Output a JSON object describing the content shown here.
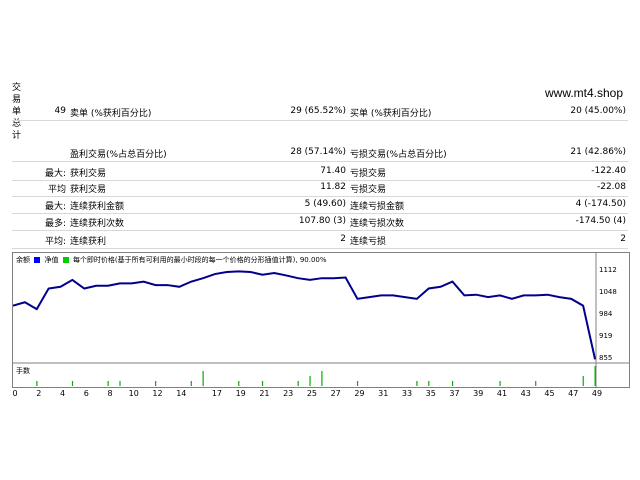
{
  "side_label": [
    "交",
    "易",
    "单",
    "总",
    "计"
  ],
  "website": "www.mt4.shop",
  "rows": [
    {
      "lbl": "",
      "left_num": "49",
      "left_label": "卖单 (%获利百分比)",
      "left_val": "29 (65.52%)",
      "right_label": "买单 (%获利百分比)",
      "right_val": "20 (45.00%)"
    },
    {
      "lbl": "",
      "left_num": "",
      "left_label": "盈利交易(%占总百分比)",
      "left_val": "28 (57.14%)",
      "right_label": "亏损交易(%占总百分比)",
      "right_val": "21 (42.86%)"
    },
    {
      "lbl": "最大:",
      "left_num": "",
      "left_label": "获利交易",
      "left_val": "71.40",
      "right_label": "亏损交易",
      "right_val": "-122.40"
    },
    {
      "lbl": "平均",
      "left_num": "",
      "left_label": "获利交易",
      "left_val": "11.82",
      "right_label": "亏损交易",
      "right_val": "-22.08"
    },
    {
      "lbl": "最大:",
      "left_num": "",
      "left_label": "连续获利金额",
      "left_val": "5 (49.60)",
      "right_label": "连续亏损金额",
      "right_val": "4 (-174.50)"
    },
    {
      "lbl": "最多:",
      "left_num": "",
      "left_label": "连续获利次数",
      "left_val": "107.80 (3)",
      "right_label": "连续亏损次数",
      "right_val": "-174.50 (4)"
    },
    {
      "lbl": "平均:",
      "left_num": "",
      "left_label": "连续获利",
      "left_val": "2",
      "right_label": "连续亏损",
      "right_val": "2"
    }
  ],
  "chart_legend": {
    "balance": "余额",
    "equity": "净值",
    "desc": "每个即时价格(基于所有可利用的最小时段的每一个价格的分形插值计算), 90.00%"
  },
  "volume_label": "手数",
  "colors": {
    "line": "#00008b",
    "balance_sw": "#0000ff",
    "equity_sw": "#00cc00",
    "volume": "#00b000"
  },
  "chart_data": {
    "type": "line",
    "ylim": [
      855,
      1140
    ],
    "yticks": [
      1112,
      1048,
      984,
      919,
      855
    ],
    "xticks": [
      0,
      2,
      4,
      6,
      8,
      10,
      12,
      14,
      17,
      19,
      21,
      23,
      25,
      27,
      29,
      31,
      33,
      35,
      37,
      39,
      41,
      43,
      45,
      47,
      49
    ],
    "x": [
      0,
      1,
      2,
      3,
      4,
      5,
      6,
      7,
      8,
      9,
      10,
      11,
      12,
      13,
      14,
      15,
      16,
      17,
      18,
      19,
      20,
      21,
      22,
      23,
      24,
      25,
      26,
      27,
      28,
      29,
      30,
      31,
      32,
      33,
      34,
      35,
      36,
      37,
      38,
      39,
      40,
      41,
      42,
      43,
      44,
      45,
      46,
      47,
      48,
      49
    ],
    "y": [
      1010,
      1020,
      1000,
      1060,
      1065,
      1085,
      1060,
      1068,
      1068,
      1075,
      1075,
      1080,
      1070,
      1070,
      1065,
      1080,
      1090,
      1102,
      1108,
      1110,
      1108,
      1100,
      1105,
      1098,
      1090,
      1085,
      1090,
      1090,
      1092,
      1030,
      1035,
      1040,
      1040,
      1035,
      1030,
      1060,
      1065,
      1080,
      1040,
      1042,
      1035,
      1040,
      1030,
      1040,
      1040,
      1042,
      1035,
      1030,
      1010,
      855
    ],
    "volume": [
      0,
      0,
      1,
      0,
      0,
      1,
      0,
      0,
      1,
      1,
      0,
      0,
      1,
      0,
      0,
      1,
      3,
      0,
      0,
      1,
      0,
      1,
      0,
      0,
      1,
      2,
      3,
      0,
      0,
      1,
      0,
      0,
      0,
      0,
      1,
      1,
      0,
      1,
      0,
      0,
      0,
      1,
      0,
      0,
      1,
      0,
      0,
      0,
      2,
      4
    ]
  }
}
